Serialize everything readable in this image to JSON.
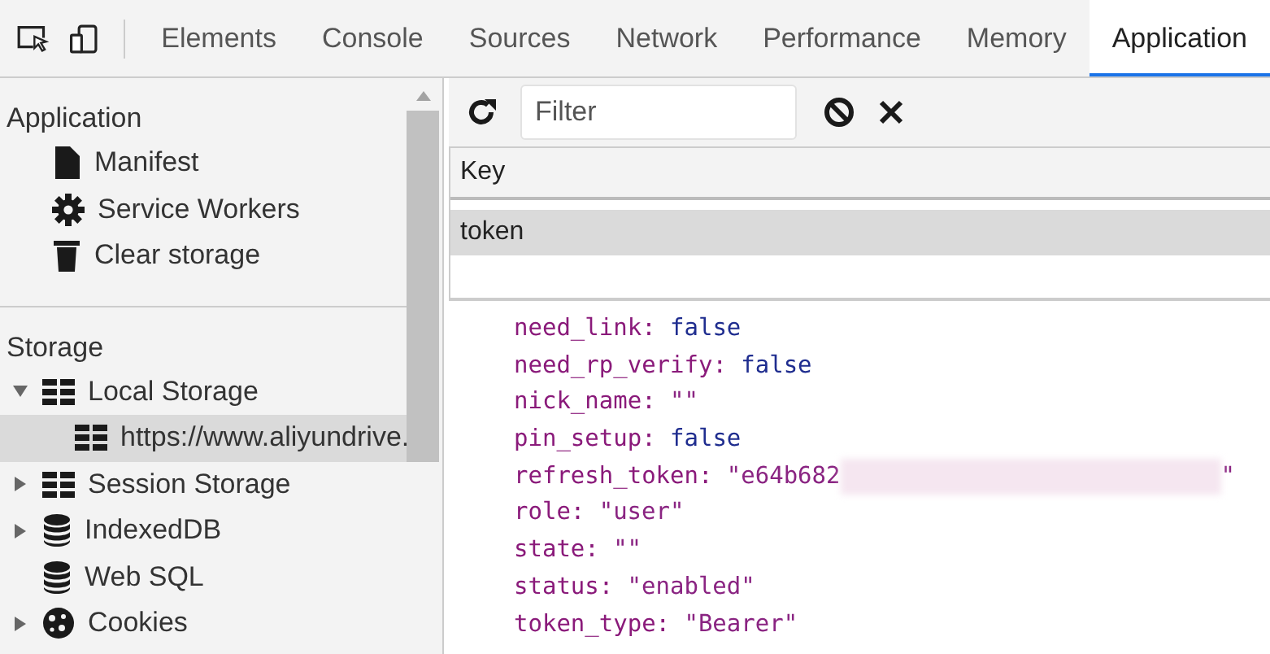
{
  "toolbar": {
    "tabs": [
      {
        "label": "Elements",
        "selected": false
      },
      {
        "label": "Console",
        "selected": false
      },
      {
        "label": "Sources",
        "selected": false
      },
      {
        "label": "Network",
        "selected": false
      },
      {
        "label": "Performance",
        "selected": false
      },
      {
        "label": "Memory",
        "selected": false
      },
      {
        "label": "Application",
        "selected": true
      }
    ]
  },
  "sidebar": {
    "sections": [
      {
        "title": "Application",
        "items": [
          {
            "label": "Manifest",
            "kind": "file",
            "selected": false
          },
          {
            "label": "Service Workers",
            "kind": "gear",
            "selected": false
          },
          {
            "label": "Clear storage",
            "kind": "trash",
            "selected": false
          }
        ]
      },
      {
        "title": "Storage",
        "items": [
          {
            "label": "Local Storage",
            "kind": "grid",
            "selected": false,
            "expanded": true,
            "children": [
              {
                "label": "https://www.aliyundrive.",
                "kind": "grid",
                "selected": true
              }
            ]
          },
          {
            "label": "Session Storage",
            "kind": "grid",
            "selected": false,
            "expanded": false
          },
          {
            "label": "IndexedDB",
            "kind": "db",
            "selected": false,
            "expanded": false
          },
          {
            "label": "Web SQL",
            "kind": "db",
            "selected": false
          },
          {
            "label": "Cookies",
            "kind": "cookie",
            "selected": false,
            "expanded": false
          }
        ]
      }
    ]
  },
  "storage": {
    "filter": {
      "placeholder": "Filter"
    },
    "table": {
      "columns": [
        "Key"
      ],
      "rows": [
        {
          "key": "token",
          "selected": true
        }
      ]
    },
    "value_lines": [
      {
        "key": "need_link:",
        "value": "false",
        "kind": "bool"
      },
      {
        "key": "need_rp_verify:",
        "value": "false",
        "kind": "bool"
      },
      {
        "key": "nick_name:",
        "value": "\"\"",
        "kind": "string"
      },
      {
        "key": "pin_setup:",
        "value": "false",
        "kind": "bool"
      },
      {
        "key": "refresh_token:",
        "value": "\"e64b682",
        "value_end": "\"",
        "kind": "string",
        "redacted": true
      },
      {
        "key": "role:",
        "value": "\"user\"",
        "kind": "string"
      },
      {
        "key": "state:",
        "value": "\"\"",
        "kind": "string"
      },
      {
        "key": "status:",
        "value": "\"enabled\"",
        "kind": "string"
      },
      {
        "key": "token_type:",
        "value": "\"Bearer\"",
        "kind": "string"
      }
    ]
  }
}
